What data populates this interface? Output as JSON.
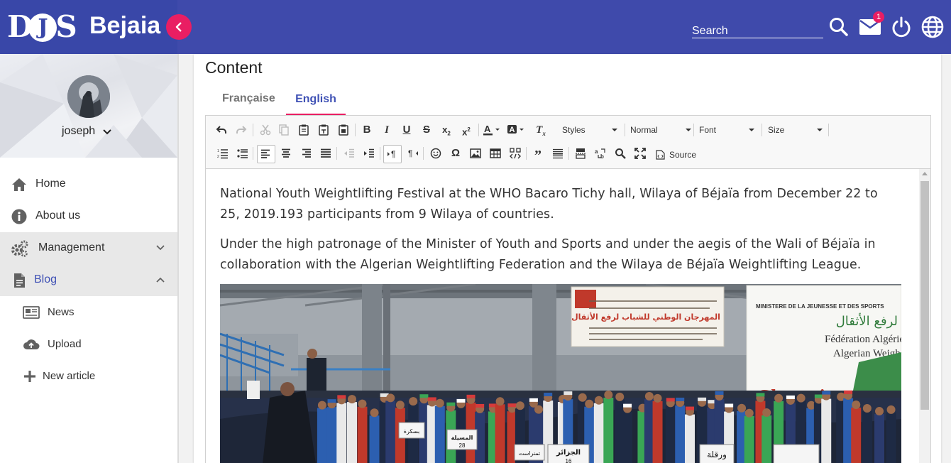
{
  "header": {
    "logo_text": "DJS",
    "city": "Bejaia",
    "search_placeholder": "Search",
    "mail_badge": "1"
  },
  "sidebar": {
    "username": "joseph",
    "items": [
      {
        "label": "Home",
        "icon": "home-icon"
      },
      {
        "label": "About us",
        "icon": "info-icon"
      },
      {
        "label": "Management",
        "icon": "gears-icon",
        "expanded": false
      },
      {
        "label": "Blog",
        "icon": "document-icon",
        "expanded": true
      },
      {
        "label": "News",
        "icon": "newspaper-icon"
      },
      {
        "label": "Upload",
        "icon": "cloud-upload-icon"
      },
      {
        "label": "New article",
        "icon": "plus-icon"
      }
    ]
  },
  "main": {
    "title": "Content",
    "tabs": [
      {
        "label": "Française",
        "active": false
      },
      {
        "label": "English",
        "active": true
      }
    ],
    "editor": {
      "styles_label": "Styles",
      "format_label": "Normal",
      "font_label": "Font",
      "size_label": "Size",
      "source_label": "Source",
      "paragraphs": [
        "National Youth Weightlifting Festival at the WHO Bacaro Tichy hall, Wilaya of Béjaïa from December 22 to 25, 2019.193 participants from 9 Wilaya of countries.",
        "Under the high patronage of the Minister of Youth and Sports and under the aegis of the Wali of Béjaïa in collaboration with the Algerian Weightlifting Federation and the Wilaya de Béjaïa Weightlifting League."
      ]
    },
    "photo": {
      "banner_top_lines": [
        "المهرجان الوطني للشباب لرفع الأثقال"
      ],
      "banner_right_title": "MINISTERE DE LA JEUNESSE ET DES SPORTS",
      "banner_right_arabic": "لرفع الأثقال",
      "banner_right_line1": "Fédération Algérie",
      "banner_right_line2": "Algerian Weigh",
      "banner_right_word": "Championnat",
      "sign_1": "المسيلة",
      "sign_1_num": "28",
      "sign_2": "الجزائر",
      "sign_2_num": "16",
      "sign_3": "ورقلة",
      "sign_4": "تمنراست",
      "sign_5": "بسكرة"
    }
  },
  "colors": {
    "topbar": "#3f4aab",
    "accent": "#e91e63",
    "link": "#3f51b5"
  }
}
